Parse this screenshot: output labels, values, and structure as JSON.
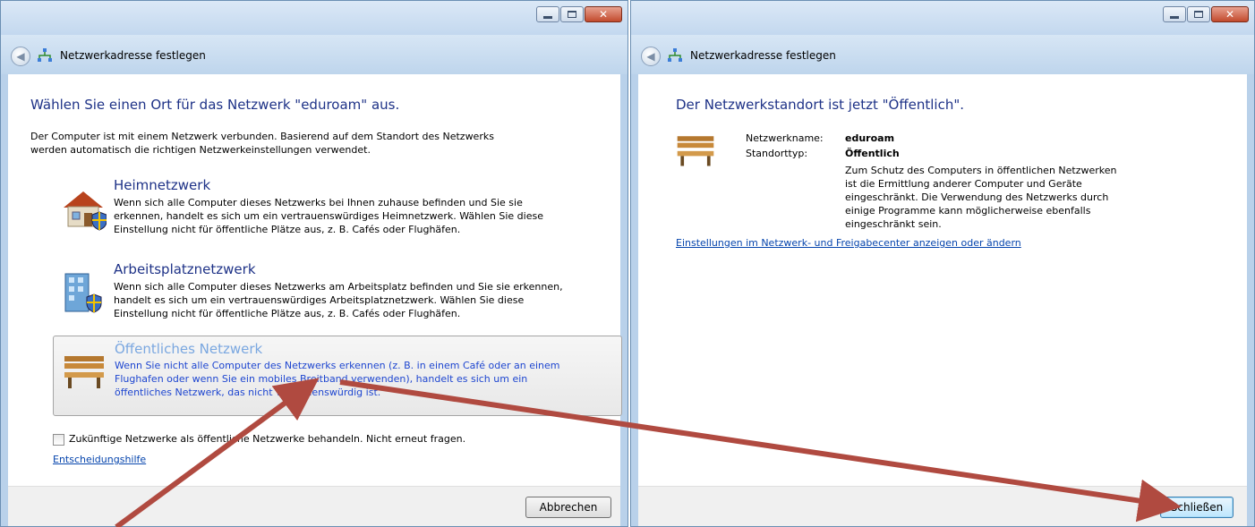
{
  "left_window": {
    "nav_title": "Netzwerkadresse festlegen",
    "heading": "Wählen Sie einen Ort für das Netzwerk \"eduroam\" aus.",
    "intro_line1": "Der Computer ist mit einem Netzwerk verbunden. Basierend auf dem Standort des Netzwerks",
    "intro_line2": "werden automatisch die richtigen Netzwerkeinstellungen verwendet.",
    "options": [
      {
        "title": "Heimnetzwerk",
        "lines": [
          "Wenn sich alle Computer dieses Netzwerks bei Ihnen zuhause befinden und Sie sie",
          "erkennen, handelt es sich um ein vertrauenswürdiges Heimnetzwerk. Wählen Sie diese",
          "Einstellung nicht für öffentliche Plätze aus, z. B. Cafés oder Flughäfen."
        ]
      },
      {
        "title": "Arbeitsplatznetzwerk",
        "lines": [
          "Wenn sich alle Computer dieses Netzwerks am Arbeitsplatz befinden und Sie sie erkennen,",
          "handelt es sich um ein vertrauenswürdiges Arbeitsplatznetzwerk. Wählen Sie diese",
          "Einstellung nicht für öffentliche Plätze aus, z. B. Cafés oder Flughäfen."
        ]
      },
      {
        "title": "Öffentliches Netzwerk",
        "lines": [
          "Wenn Sie nicht alle Computer des Netzwerks erkennen (z. B. in einem Café oder an einem",
          "Flughafen oder wenn Sie ein mobiles Breitband verwenden), handelt es sich um ein",
          "öffentliches Netzwerk, das nicht vertrauenswürdig ist."
        ]
      }
    ],
    "checkbox_label": "Zukünftige Netzwerke als öffentliche Netzwerke behandeln. Nicht erneut fragen.",
    "help_link": "Entscheidungshilfe",
    "cancel_button": "Abbrechen"
  },
  "right_window": {
    "nav_title": "Netzwerkadresse festlegen",
    "heading": "Der Netzwerkstandort ist jetzt \"Öffentlich\".",
    "name_label": "Netzwerkname:",
    "name_value": "eduroam",
    "type_label": "Standorttyp:",
    "type_value": "Öffentlich",
    "desc_lines": [
      "Zum Schutz des Computers in öffentlichen Netzwerken",
      "ist die Ermittlung anderer Computer und Geräte",
      "eingeschränkt. Die Verwendung des Netzwerks durch",
      "einige Programme kann möglicherweise ebenfalls",
      "eingeschränkt sein."
    ],
    "settings_link": "Einstellungen im Netzwerk- und Freigabecenter anzeigen oder ändern",
    "close_button": "Schließen"
  },
  "icons": {
    "back": "back-arrow-icon",
    "network": "network-icon",
    "home": "house-icon",
    "work": "office-building-icon",
    "public": "park-bench-icon"
  },
  "colors": {
    "heading": "#1e3287",
    "link": "#0645ad",
    "annotation_arrow": "#b04a40",
    "close_button": "#c24a2d"
  }
}
